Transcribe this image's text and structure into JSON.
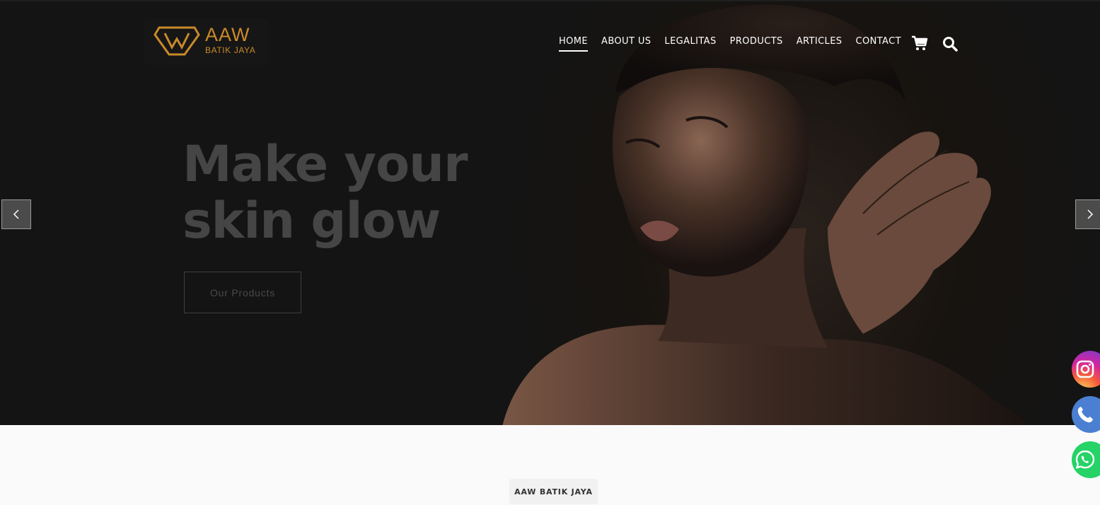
{
  "brand": {
    "name": "AAW",
    "subtitle": "BATIK JAYA",
    "accent": "#c98a2b"
  },
  "nav": {
    "items": [
      {
        "label": "HOME",
        "active": true
      },
      {
        "label": "ABOUT US"
      },
      {
        "label": "LEGALITAS"
      },
      {
        "label": "PRODUCTS"
      },
      {
        "label": "ARTICLES"
      },
      {
        "label": "CONTACT"
      }
    ],
    "icons": [
      "cart-icon",
      "search-icon"
    ]
  },
  "hero": {
    "headline_line1": "Make your",
    "headline_line2": "skin glow",
    "cta_label": "Our Products"
  },
  "slider": {
    "prev_icon": "chevron-left-icon",
    "next_icon": "chevron-right-icon"
  },
  "social": [
    "instagram-icon",
    "phone-icon",
    "whatsapp-icon"
  ],
  "section": {
    "badge": "AAW BATIK JAYA"
  }
}
